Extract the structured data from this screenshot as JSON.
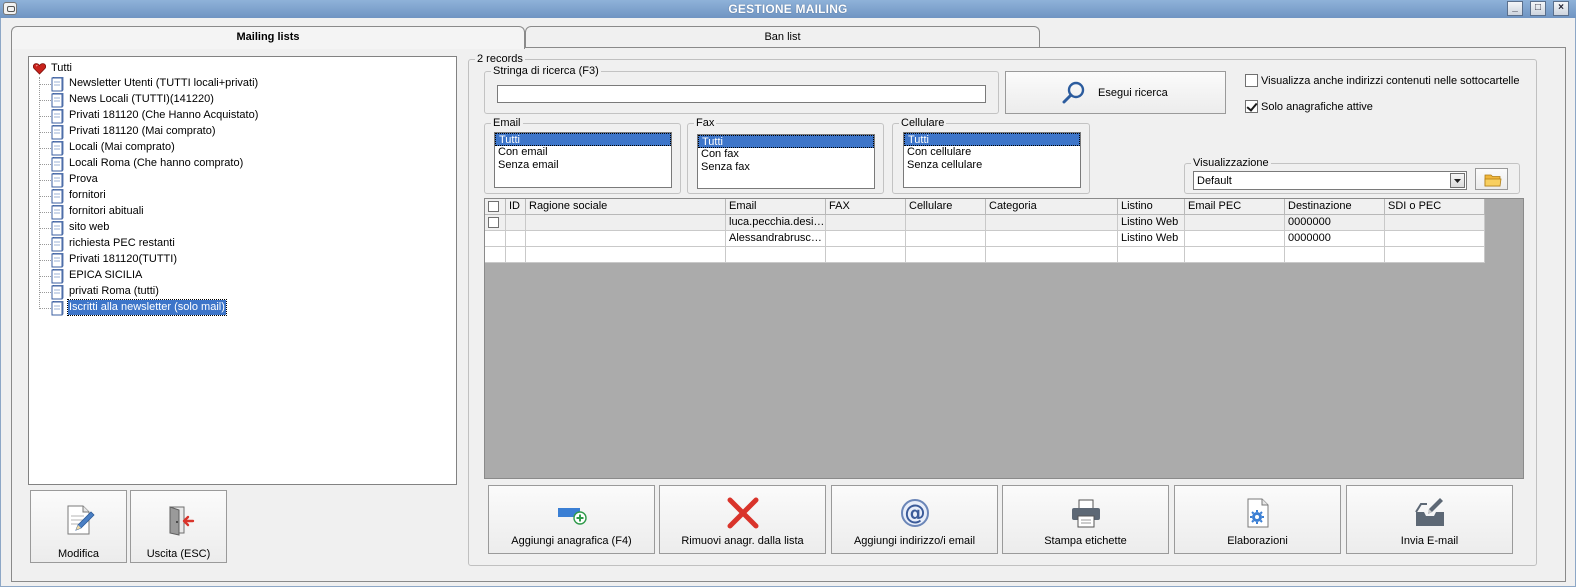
{
  "window": {
    "title": "GESTIONE MAILING",
    "controls": [
      "_",
      "□",
      "×"
    ]
  },
  "tabs": [
    {
      "label": "Mailing lists",
      "active": true
    },
    {
      "label": "Ban list",
      "active": false
    }
  ],
  "tree": {
    "root": "Tutti",
    "items": [
      "Newsletter Utenti (TUTTI locali+privati)",
      "News Locali (TUTTI)(141220)",
      "Privati 181120 (Che Hanno Acquistato)",
      "Privati 181120 (Mai comprato)",
      "Locali (Mai comprato)",
      "Locali Roma (Che hanno comprato)",
      "Prova",
      "fornitori",
      "fornitori abituali",
      "sito web",
      "richiesta PEC restanti",
      "Privati 181120(TUTTI)",
      "EPICA SICILIA",
      "privati Roma (tutti)",
      "Iscritti alla newsletter (solo mail)"
    ],
    "selected_index": 14
  },
  "left_buttons": {
    "edit": "Modifica",
    "exit": "Uscita (ESC)"
  },
  "records": {
    "label": "2 records"
  },
  "search": {
    "group_label": "Stringa di ricerca (F3)",
    "value": "",
    "button": "Esegui ricerca"
  },
  "options": {
    "subfolders": {
      "label": "Visualizza anche indirizzi contenuti nelle sottocartelle",
      "checked": false
    },
    "active_only": {
      "label": "Solo anagrafiche attive",
      "checked": true
    }
  },
  "filters": {
    "email": {
      "label": "Email",
      "options": [
        "Tutti",
        "Con email",
        "Senza email"
      ],
      "selected": 0
    },
    "fax": {
      "label": "Fax",
      "options": [
        "Tutti",
        "Con fax",
        "Senza fax"
      ],
      "selected": 0
    },
    "cell": {
      "label": "Cellulare",
      "options": [
        "Tutti",
        "Con cellulare",
        "Senza cellulare"
      ],
      "selected": 0
    }
  },
  "view": {
    "label": "Visualizzazione",
    "selected": "Default"
  },
  "grid": {
    "columns": [
      "",
      "ID",
      "Ragione sociale",
      "Email",
      "FAX",
      "Cellulare",
      "Categoria",
      "Listino",
      "Email PEC",
      "Destinazione",
      "SDI o PEC"
    ],
    "rows": [
      [
        "",
        "",
        "",
        "luca.pecchia.desi…",
        "",
        "",
        "",
        "Listino Web",
        "",
        "0000000",
        ""
      ],
      [
        "",
        "",
        "",
        "Alessandrabrusc…",
        "",
        "",
        "",
        "Listino Web",
        "",
        "0000000",
        ""
      ],
      [
        "",
        "",
        "",
        "",
        "",
        "",
        "",
        "",
        "",
        "",
        ""
      ]
    ]
  },
  "actions": {
    "add": "Aggiungi anagrafica (F4)",
    "remove": "Rimuovi anagr. dalla lista",
    "add_email": "Aggiungi indirizzo/i email",
    "print": "Stampa etichette",
    "process": "Elaborazioni",
    "send": "Invia E-mail"
  },
  "colors": {
    "titlebar": "#7da2cd",
    "selection": "#3d75c9",
    "remove_icon": "#d9342b"
  }
}
